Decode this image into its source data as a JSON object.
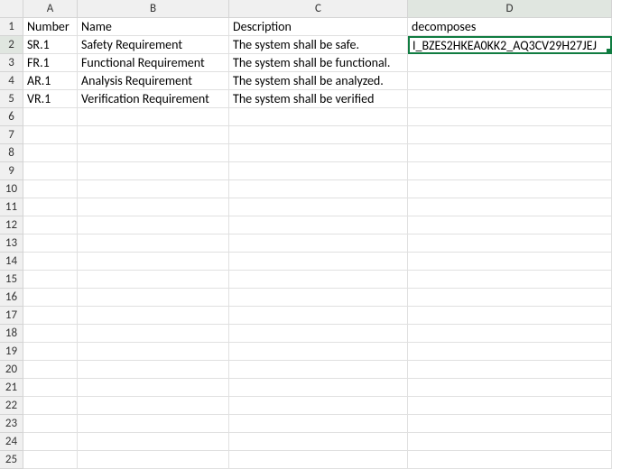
{
  "columns": [
    "A",
    "B",
    "C",
    "D"
  ],
  "rowCount": 25,
  "selected": {
    "row": 2,
    "col": "D"
  },
  "cells": {
    "A1": "Number",
    "B1": "Name",
    "C1": "Description",
    "D1": "decomposes",
    "A2": "SR.1",
    "B2": "Safety Requirement",
    "C2": "The system shall be safe.",
    "D2": "I_BZES2HKEA0KK2_AQ3CV29H27JEJ",
    "A3": "FR.1",
    "B3": "Functional Requirement",
    "C3": "The system shall be functional.",
    "A4": "AR.1",
    "B4": "Analysis Requirement",
    "C4": "The system shall be analyzed.",
    "A5": "VR.1",
    "B5": "Verification Requirement",
    "C5": "The system shall be verified"
  },
  "chart_data": {
    "type": "table",
    "headers": [
      "Number",
      "Name",
      "Description",
      "decomposes"
    ],
    "rows": [
      [
        "SR.1",
        "Safety Requirement",
        "The system shall be safe.",
        "I_BZES2HKEA0KK2_AQ3CV29H27JEJ"
      ],
      [
        "FR.1",
        "Functional Requirement",
        "The system shall be functional.",
        ""
      ],
      [
        "AR.1",
        "Analysis Requirement",
        "The system shall be analyzed.",
        ""
      ],
      [
        "VR.1",
        "Verification Requirement",
        "The system shall be verified",
        ""
      ]
    ]
  }
}
